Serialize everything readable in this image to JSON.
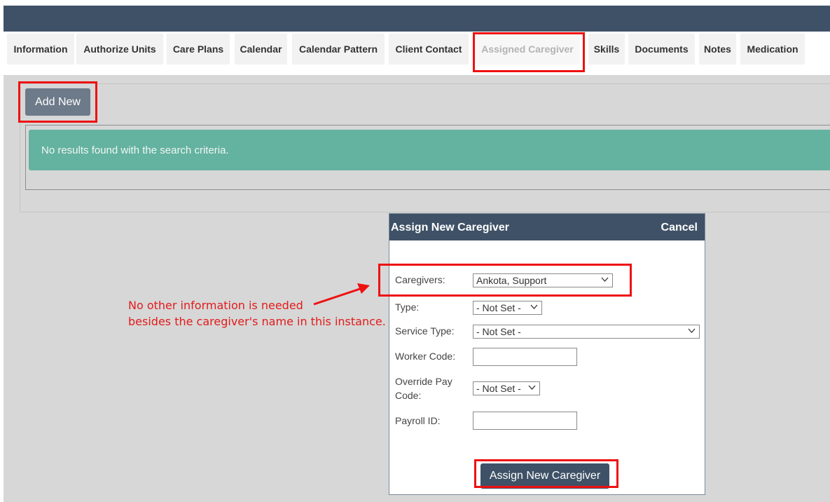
{
  "tabs": [
    {
      "label": "Information",
      "active": false
    },
    {
      "label": "Authorize Units",
      "active": false
    },
    {
      "label": "Care Plans",
      "active": false
    },
    {
      "label": "Calendar",
      "active": false
    },
    {
      "label": "Calendar Pattern",
      "active": false
    },
    {
      "label": "Client Contact",
      "active": false
    },
    {
      "label": "Assigned Caregiver",
      "active": true
    },
    {
      "label": "Skills",
      "active": false
    },
    {
      "label": "Documents",
      "active": false
    },
    {
      "label": "Notes",
      "active": false
    },
    {
      "label": "Medication",
      "active": false
    }
  ],
  "main": {
    "add_new_label": "Add New",
    "no_results_text": "No results found with the search criteria."
  },
  "annotation": {
    "line1": "No other information is needed",
    "line2": "besides the caregiver's name in this instance."
  },
  "modal": {
    "title": "Assign New Caregiver",
    "cancel_label": "Cancel",
    "fields": {
      "caregivers": {
        "label": "Caregivers:",
        "value": "Ankota, Support"
      },
      "type": {
        "label": "Type:",
        "value": "- Not Set -"
      },
      "service_type": {
        "label": "Service Type:",
        "value": "- Not Set -"
      },
      "worker_code": {
        "label": "Worker Code:",
        "value": ""
      },
      "override_pay_code": {
        "label_line1": "Override Pay",
        "label_line2": "Code:",
        "value": "- Not Set -"
      },
      "payroll_id": {
        "label": "Payroll ID:",
        "value": ""
      }
    },
    "submit_label": "Assign New Caregiver"
  },
  "colors": {
    "header_navy": "#3e5166",
    "alert_teal": "#64b2a0",
    "annotation_red": "#ee1111"
  }
}
